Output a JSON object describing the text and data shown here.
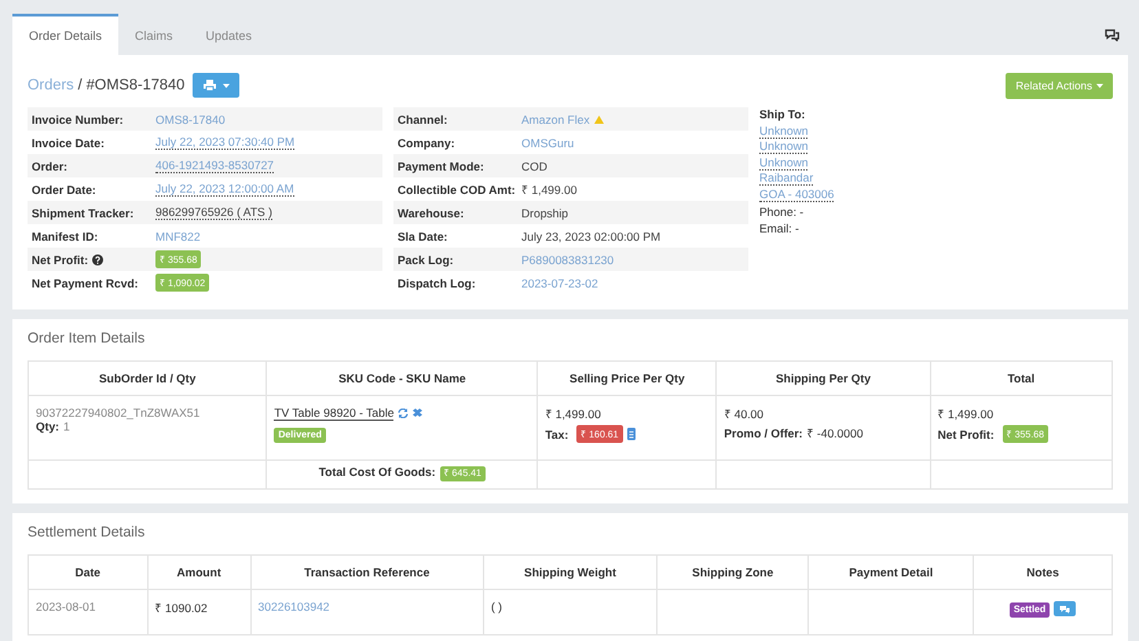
{
  "tabs": [
    {
      "label": "Order Details",
      "selected": true
    },
    {
      "label": "Claims",
      "selected": false
    },
    {
      "label": "Updates",
      "selected": false
    }
  ],
  "breadcrumb": {
    "link": "Orders",
    "separator": "/",
    "current": "#OMS8-17840"
  },
  "related_actions": "Related Actions",
  "info_columns": [
    [
      {
        "label": "Invoice Number:",
        "value": "OMS8-17840",
        "kind": "link"
      },
      {
        "label": "Invoice Date:",
        "value": "July 22, 2023 07:30:40 PM",
        "kind": "dotted-link"
      },
      {
        "label": "Order:",
        "value": "406-1921493-8530727",
        "kind": "dotted-link"
      },
      {
        "label": "Order Date:",
        "value": "July 22, 2023 12:00:00 AM",
        "kind": "dotted-link"
      },
      {
        "label": "Shipment Tracker:",
        "value": "986299765926 ( ATS )",
        "kind": "dotted-text"
      },
      {
        "label": "Manifest ID:",
        "value": "MNF822",
        "kind": "link"
      },
      {
        "label": "Net Profit:",
        "value": "₹ 355.68",
        "kind": "badge",
        "color": "#8cc152",
        "help": true
      },
      {
        "label": "Net Payment Rcvd:",
        "value": "₹ 1,090.02",
        "kind": "badge",
        "color": "#8cc152"
      }
    ],
    [
      {
        "label": "Channel:",
        "value": "Amazon Flex",
        "kind": "link",
        "warning": true
      },
      {
        "label": "Company:",
        "value": "OMSGuru",
        "kind": "link"
      },
      {
        "label": "Payment Mode:",
        "value": "COD",
        "kind": "text"
      },
      {
        "label": "Collectible COD Amt:",
        "value": "₹ 1,499.00",
        "kind": "text"
      },
      {
        "label": "Warehouse:",
        "value": "Dropship",
        "kind": "text"
      },
      {
        "label": "Sla Date:",
        "value": "July 23, 2023 02:00:00 PM",
        "kind": "text"
      },
      {
        "label": "Pack Log:",
        "value": "P6890083831230",
        "kind": "link"
      },
      {
        "label": "Dispatch Log:",
        "value": "2023-07-23-02",
        "kind": "link"
      }
    ]
  ],
  "ship_to": {
    "title": "Ship To:",
    "lines": [
      "Unknown",
      "Unknown",
      "Unknown",
      "Raibandar",
      "GOA - 403006"
    ],
    "contacts": [
      "Phone: -",
      "Email: -"
    ]
  },
  "order_items": {
    "title": "Order Item Details",
    "columns": [
      "SubOrder Id / Qty",
      "SKU Code - SKU Name",
      "Selling Price Per Qty",
      "Shipping Per Qty",
      "Total"
    ],
    "row": {
      "suborder": "90372227940802_TnZ8WAX51",
      "qty_label": "Qty:",
      "qty": "1",
      "sku": "TV Table 98920 - Table",
      "status": {
        "text": "Delivered",
        "color": "#8cc152"
      },
      "price": "₹  1,499.00",
      "tax_label": "Tax:",
      "tax": {
        "text": "₹ 160.61",
        "color": "#d9534f"
      },
      "shipping": "₹ 40.00",
      "promo_label": "Promo / Offer:",
      "promo": "₹ -40.0000",
      "total": "₹ 1,499.00",
      "profit_label": "Net Profit:",
      "profit": {
        "text": "₹ 355.68",
        "color": "#8cc152"
      }
    },
    "footer": {
      "label": "Total Cost Of Goods:",
      "value": {
        "text": "₹ 645.41",
        "color": "#8cc152"
      }
    }
  },
  "settlement": {
    "title": "Settlement Details",
    "columns": [
      "Date",
      "Amount",
      "Transaction Reference",
      "Shipping Weight",
      "Shipping Zone",
      "Payment Detail",
      "Notes"
    ],
    "rows": [
      {
        "date": "2023-08-01",
        "amount": "₹ 1090.02",
        "reference": "30226103942",
        "weight": "( )",
        "status": {
          "text": "Settled",
          "color": "#8e44ad"
        }
      }
    ]
  }
}
